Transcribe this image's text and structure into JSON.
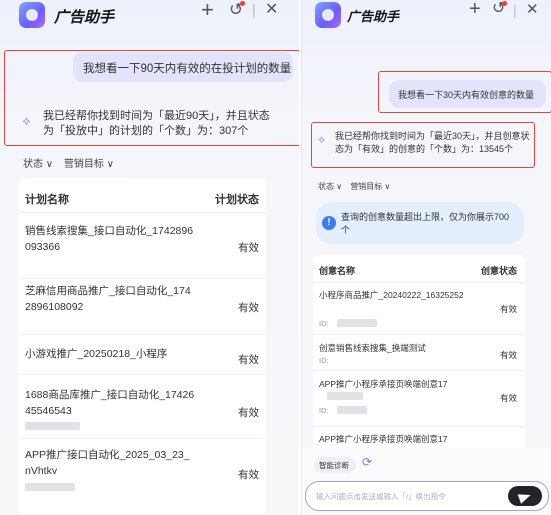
{
  "left": {
    "header": {
      "title": "广告助手",
      "add_icon": "+",
      "history_icon": "↺",
      "separator": "|",
      "close_icon": "✕"
    },
    "user_message": "我想看一下90天内有效的在投计划的数量",
    "bot_message": "我已经帮你找到时间为「最近90天」，并且状态为「投放中」的计划的「个数」为：307个",
    "filters": {
      "status": "状态 ∨",
      "goal": "营销目标 ∨"
    },
    "table": {
      "col_name": "计划名称",
      "col_status": "计划状态",
      "rows": [
        {
          "name": "销售线索搜集_接口自动化_1742896093366",
          "status": "有效"
        },
        {
          "name": "芝麻信用商品推广_接口自动化_1742896108092",
          "status": "有效"
        },
        {
          "name": "小游戏推广_20250218_小程序",
          "status": "有效"
        },
        {
          "name": "1688商品库推广_接口自动化_1742645546543",
          "status": "有效"
        },
        {
          "name": "APP推广接口自动化_2025_03_23_nVhtkv",
          "status": "有效"
        }
      ]
    }
  },
  "right": {
    "header": {
      "title": "广告助手",
      "add_icon": "+",
      "history_icon": "↺",
      "separator": "|",
      "close_icon": "✕"
    },
    "user_message": "我想看一下30天内有效创意的数量",
    "bot_message": "我已经帮你找到时间为「最近30天」，并且创意状态为「有效」的创意的「个数」为：13545个",
    "filters": {
      "status": "状态 ∨",
      "goal": "营销目标 ∨"
    },
    "notice": "查询的创意数量超出上限，仅为你展示700个",
    "table": {
      "col_name": "创意名称",
      "col_status": "创意状态",
      "id_label": "ID:",
      "rows": [
        {
          "name": "小程序商品推广_20240222_16325252",
          "status": "有效"
        },
        {
          "name": "创意销售线索搜集_换端测试",
          "status": "有效"
        },
        {
          "name": "APP推广小程序承接页唤端创意17",
          "status": "有效"
        },
        {
          "name": "APP推广小程序承接页唤端创意17",
          "status": ""
        }
      ]
    },
    "bottom": {
      "chip_label": "智能诊断",
      "refresh_icon": "⟳",
      "input_placeholder": "输入问题点击发送或输入「/」唤出指令"
    }
  },
  "colors": {
    "accent": "#7b6cf6",
    "highlight_border": "#e0463c",
    "user_bubble": "#e3e3fb"
  }
}
